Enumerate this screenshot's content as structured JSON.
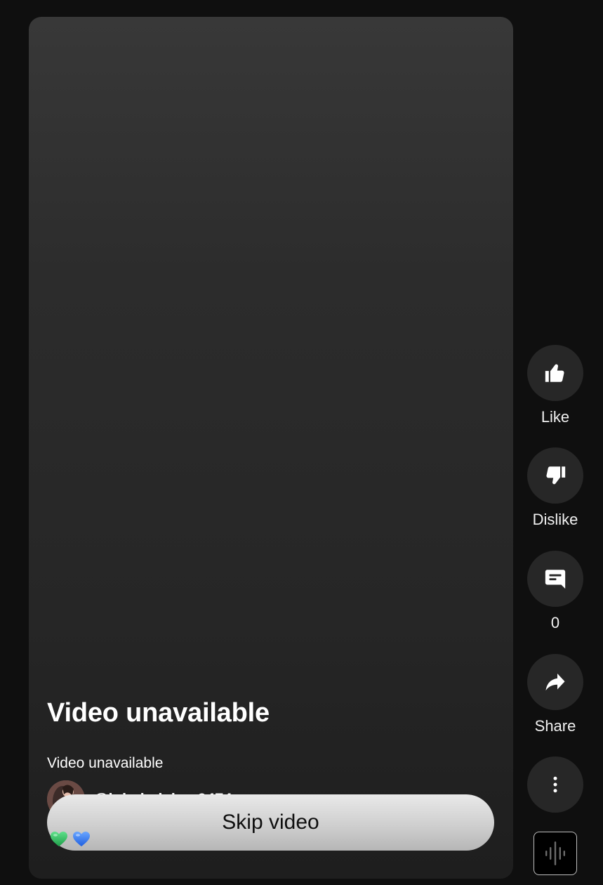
{
  "player": {
    "title": "Video unavailable",
    "subtitle": "Video unavailable",
    "channel_handle": "@lubabaislam9474",
    "skip_label": "Skip video",
    "emojis": [
      "green-heart-icon",
      "blue-heart-icon"
    ]
  },
  "actions": {
    "like_label": "Like",
    "dislike_label": "Dislike",
    "comments_count": "0",
    "share_label": "Share"
  },
  "icons": {
    "like": "thumbs-up-icon",
    "dislike": "thumbs-down-icon",
    "comments": "comment-icon",
    "share": "share-arrow-icon",
    "more": "more-vertical-icon",
    "sound": "sound-waveform-icon"
  },
  "colors": {
    "background": "#0f0f0f",
    "action_circle": "#272727",
    "skip_button": "#d9d9d9",
    "text": "#ffffff"
  }
}
